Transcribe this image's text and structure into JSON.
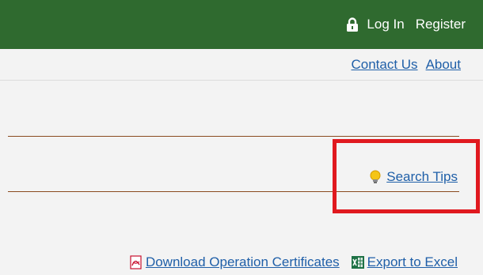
{
  "header": {
    "login_label": "Log In",
    "register_label": "Register",
    "lock_icon": "lock-icon",
    "bar_color": "#2f6a2f"
  },
  "subnav": {
    "contact_label": "Contact Us",
    "about_label": "About"
  },
  "search": {
    "tips_label": "Search Tips",
    "tips_icon": "lightbulb-icon",
    "highlight_color": "#e0191f"
  },
  "downloads": {
    "certificates_label": "Download Operation Certificates",
    "certificates_icon": "pdf-icon",
    "excel_label": "Export to Excel",
    "excel_icon": "excel-icon"
  },
  "colors": {
    "link": "#1f5fa8",
    "rule": "#8a4a1f",
    "background": "#f3f3f3"
  }
}
